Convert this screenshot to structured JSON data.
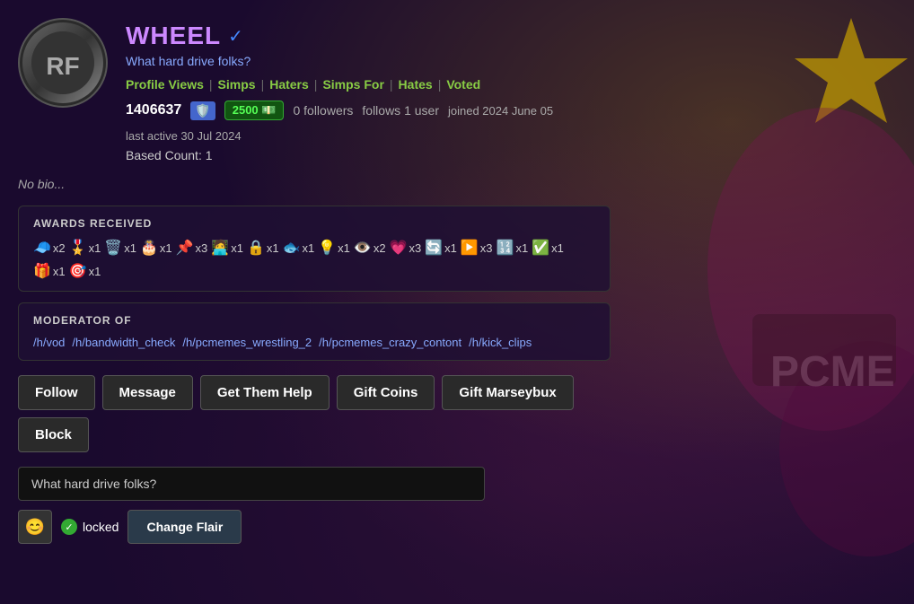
{
  "bg": {
    "color": "#1a0a2e"
  },
  "profile": {
    "username": "WHEEL",
    "tagline": "What hard drive folks?",
    "verified": true,
    "avatar_text": "RF",
    "stats": {
      "score": "1406637",
      "badge_emoji": "🛡️",
      "coins": "2500",
      "followers": "0 followers",
      "follows": "follows 1 user",
      "joined": "joined 2024 June 05",
      "last_active": "last active 30 Jul 2024",
      "based_count_label": "Based Count:",
      "based_count_value": "1"
    },
    "nav": {
      "profile_views": "Profile Views",
      "simps": "Simps",
      "haters": "Haters",
      "simps_for": "Simps For",
      "hates": "Hates",
      "voted": "Voted"
    },
    "bio": "No bio...",
    "awards": {
      "title": "AWARDS RECEIVED",
      "items": [
        {
          "emoji": "🧢",
          "count": "x2"
        },
        {
          "emoji": "🎖️",
          "count": "x1"
        },
        {
          "emoji": "🗑️",
          "count": "x1"
        },
        {
          "emoji": "🎂",
          "count": "x1"
        },
        {
          "emoji": "📌",
          "count": "x3"
        },
        {
          "emoji": "🧑‍💻",
          "count": "x1"
        },
        {
          "emoji": "🔒",
          "count": "x1"
        },
        {
          "emoji": "🐟",
          "count": "x1"
        },
        {
          "emoji": "💡",
          "count": "x1"
        },
        {
          "emoji": "👁️",
          "count": "x2"
        },
        {
          "emoji": "💗",
          "count": "x3"
        },
        {
          "emoji": "🔄",
          "count": "x1"
        },
        {
          "emoji": "▶️",
          "count": "x3"
        },
        {
          "emoji": "🔢",
          "count": "x1"
        },
        {
          "emoji": "✅",
          "count": "x1"
        },
        {
          "emoji": "🎁",
          "count": "x1"
        },
        {
          "emoji": "🎯",
          "count": "x1"
        }
      ]
    },
    "moderator": {
      "title": "MODERATOR OF",
      "communities": [
        "/h/vod",
        "/h/bandwidth_check",
        "/h/pcmemes_wrestling_2",
        "/h/pcmemes_crazy_contont",
        "/h/kick_clips"
      ]
    },
    "buttons": {
      "follow": "Follow",
      "message": "Message",
      "get_them_help": "Get Them Help",
      "gift_coins": "Gift Coins",
      "gift_marseybux": "Gift Marseybux",
      "block": "Block"
    },
    "status_input": {
      "value": "What hard drive folks?",
      "placeholder": "What hard drive folks?"
    },
    "flair": {
      "locked_label": "locked",
      "change_flair_label": "Change Flair"
    }
  }
}
